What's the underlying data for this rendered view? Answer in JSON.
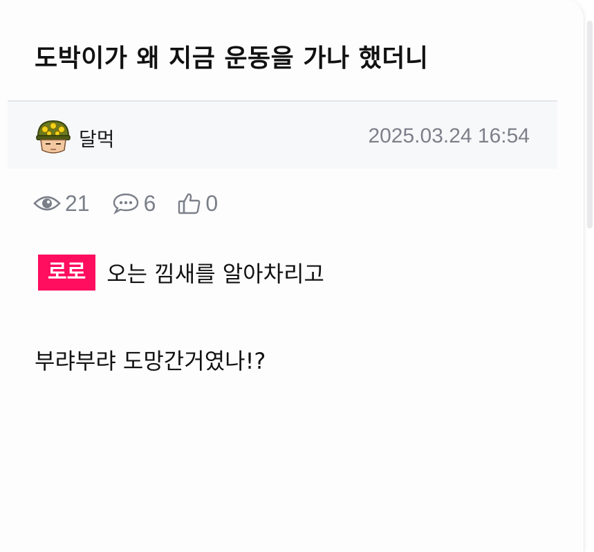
{
  "post": {
    "title": "도박이가 왜 지금 운동을 가나 했더니",
    "author": "달먹",
    "datetime": "2025.03.24 16:54",
    "author_avatar_icon": "soldier-helmet-avatar-icon"
  },
  "stats": {
    "views": "21",
    "comments": "6",
    "likes": "0",
    "icons": [
      "eye-icon",
      "comment-bubble-icon",
      "thumbs-up-icon"
    ]
  },
  "content": {
    "tag_label": "로로",
    "tag_color": "#ff0d5e",
    "line1_text": "오는 낌새를 알아차리고",
    "line2_text": "부랴부랴 도망간거였나!?"
  }
}
